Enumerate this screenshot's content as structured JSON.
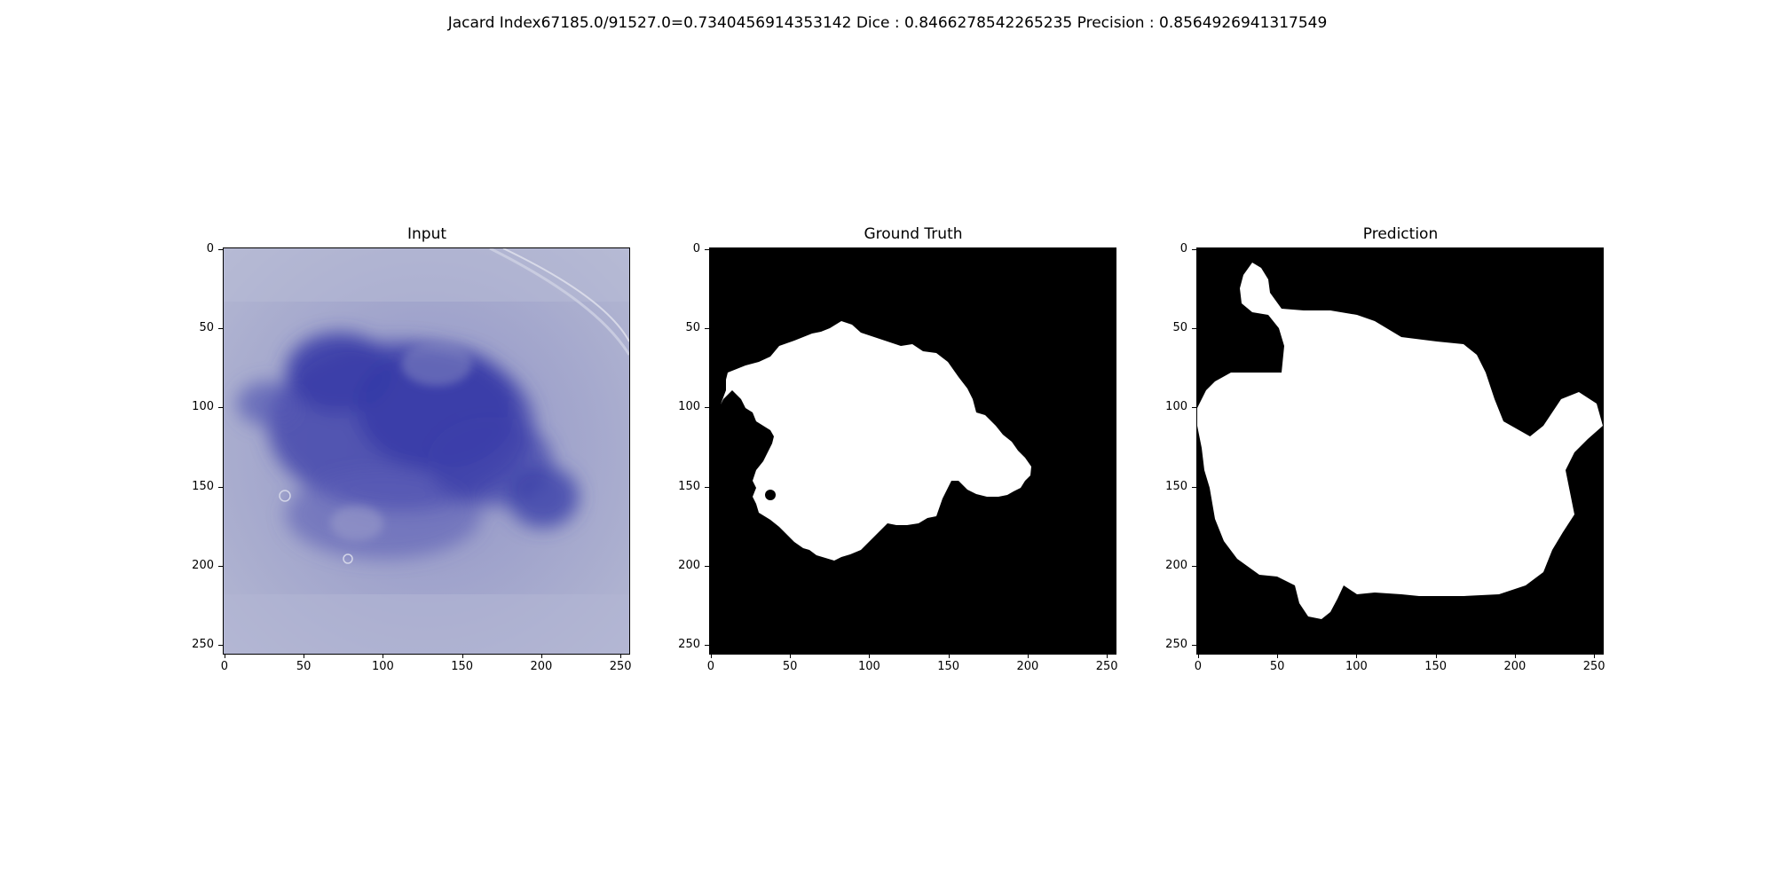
{
  "figure": {
    "suptitle": "Jacard Index67185.0/91527.0=0.7340456914353142 Dice : 0.8466278542265235 Precision : 0.8564926941317549"
  },
  "panels": [
    {
      "title": "Input"
    },
    {
      "title": "Ground Truth"
    },
    {
      "title": "Prediction"
    }
  ],
  "axes": {
    "x_ticks": [
      "0",
      "50",
      "100",
      "150",
      "200",
      "250"
    ],
    "y_ticks": [
      "0",
      "50",
      "100",
      "150",
      "200",
      "250"
    ]
  },
  "colors": {
    "mask_foreground": "#ffffff",
    "mask_background": "#000000",
    "lesion": "#3a3fa8",
    "skin": "#a7a9cf"
  }
}
